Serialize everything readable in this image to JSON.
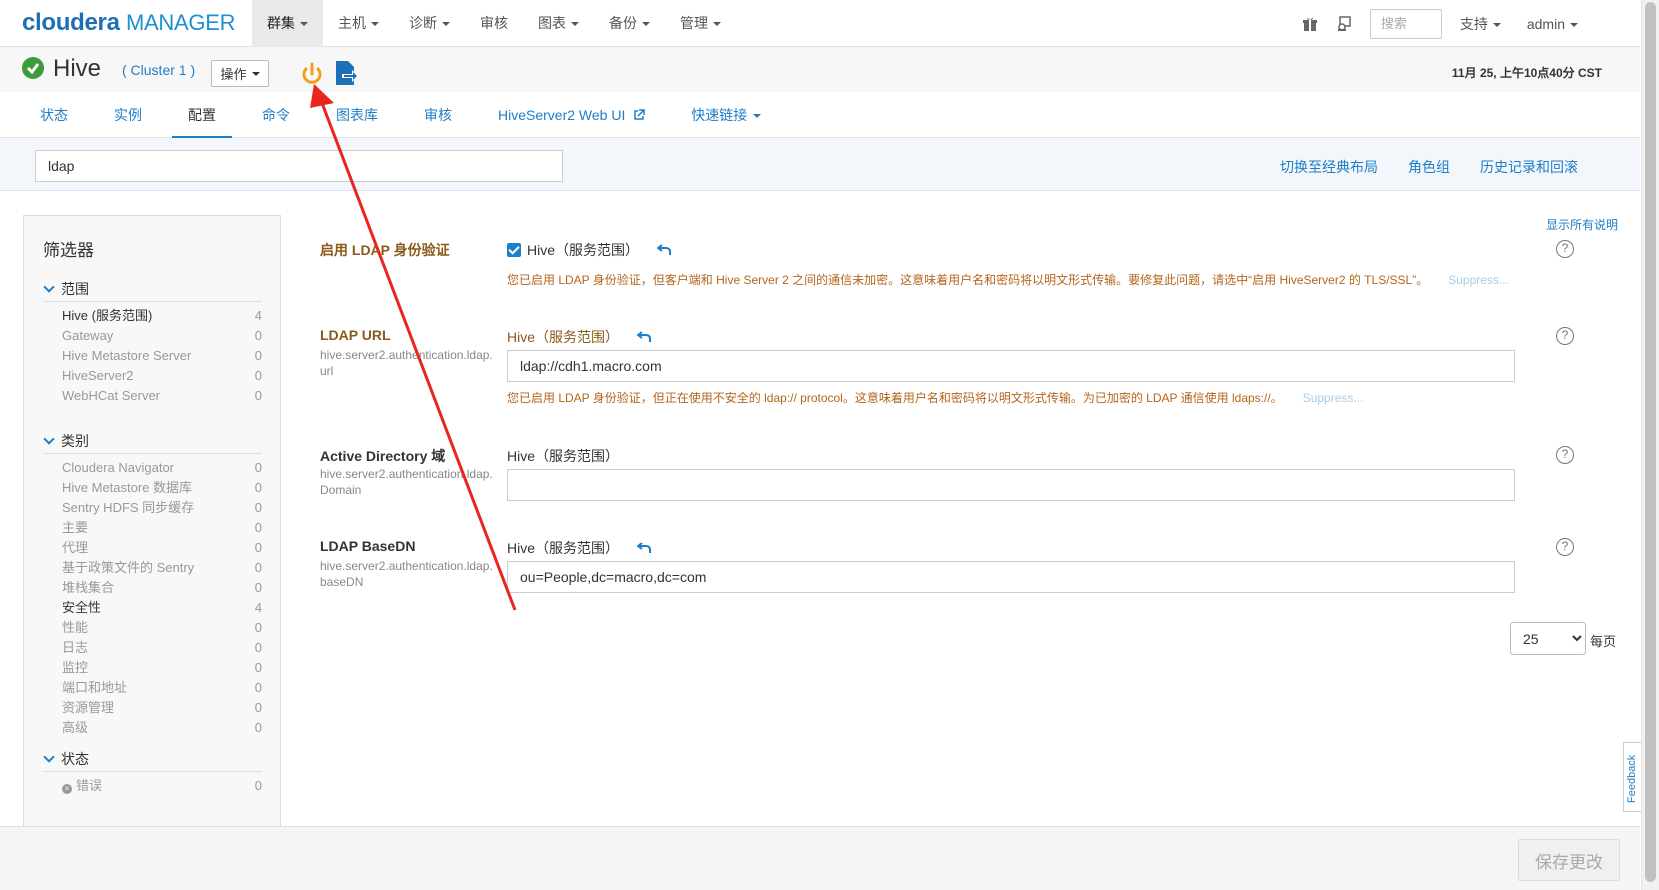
{
  "topbar": {
    "logo_brand": "cloudera",
    "logo_product": "MANAGER",
    "nav": [
      {
        "label": "群集",
        "active": true
      },
      {
        "label": "主机",
        "active": false
      },
      {
        "label": "诊断",
        "active": false
      },
      {
        "label": "审核",
        "active": false
      },
      {
        "label": "图表",
        "active": false
      },
      {
        "label": "备份",
        "active": false
      },
      {
        "label": "管理",
        "active": false
      }
    ],
    "search_placeholder": "搜索",
    "support_label": "支持",
    "user_label": "admin",
    "icons": [
      "gift-icon",
      "user-switch-icon"
    ]
  },
  "service": {
    "status_icon": "check-circle-icon",
    "name": "Hive",
    "cluster": "( Cluster 1 )",
    "actions_label": "操作",
    "timestamp": "11月 25, 上午10点40分 CST"
  },
  "tabs": [
    {
      "label": "状态"
    },
    {
      "label": "实例"
    },
    {
      "label": "配置",
      "active": true
    },
    {
      "label": "命令"
    },
    {
      "label": "图表库"
    },
    {
      "label": "审核"
    },
    {
      "label": "HiveServer2 Web UI"
    },
    {
      "label": "快速链接"
    }
  ],
  "search_band": {
    "filter_value": "ldap",
    "links": [
      "切换至经典布局",
      "角色组",
      "历史记录和回滚"
    ]
  },
  "sidebar": {
    "title": "筛选器",
    "scope": {
      "title": "范围",
      "items": [
        {
          "label": "Hive (服务范围)",
          "count": "4",
          "on": true
        },
        {
          "label": "Gateway",
          "count": "0"
        },
        {
          "label": "Hive Metastore Server",
          "count": "0"
        },
        {
          "label": "HiveServer2",
          "count": "0"
        },
        {
          "label": "WebHCat Server",
          "count": "0"
        }
      ]
    },
    "category": {
      "title": "类别",
      "items": [
        {
          "label": "Cloudera Navigator",
          "count": "0"
        },
        {
          "label": "Hive Metastore 数据库",
          "count": "0"
        },
        {
          "label": "Sentry HDFS 同步缓存",
          "count": "0"
        },
        {
          "label": "主要",
          "count": "0"
        },
        {
          "label": "代理",
          "count": "0"
        },
        {
          "label": "基于政策文件的 Sentry",
          "count": "0"
        },
        {
          "label": "堆栈集合",
          "count": "0"
        },
        {
          "label": "安全性",
          "count": "4",
          "on": true
        },
        {
          "label": "性能",
          "count": "0"
        },
        {
          "label": "日志",
          "count": "0"
        },
        {
          "label": "监控",
          "count": "0"
        },
        {
          "label": "端口和地址",
          "count": "0"
        },
        {
          "label": "资源管理",
          "count": "0"
        },
        {
          "label": "高级",
          "count": "0"
        }
      ]
    },
    "status": {
      "title": "状态",
      "items": [
        {
          "label": "错误",
          "count": "0"
        }
      ]
    }
  },
  "main": {
    "show_all": "显示所有说明",
    "props": [
      {
        "name": "启用 LDAP 身份验证",
        "key": "",
        "scope": "Hive（服务范围）",
        "checked": true,
        "warning": "您已启用 LDAP 身份验证，但客户端和 Hive Server 2 之间的通信未加密。这意味着用户名和密码将以明文形式传输。要修复此问题，请选中“启用 HiveServer2 的 TLS/SSL”。",
        "suppress": "Suppress..."
      },
      {
        "name": "LDAP URL",
        "key": "hive.server2.authentication.ldap.url",
        "scope": "Hive（服务范围）",
        "value": "ldap://cdh1.macro.com",
        "warning": "您已启用 LDAP 身份验证，但正在使用不安全的 ldap:// protocol。这意味着用户名和密码将以明文形式传输。为已加密的 LDAP 通信使用 ldaps://。",
        "suppress": "Suppress..."
      },
      {
        "name": "Active Directory 域",
        "key": "hive.server2.authentication.ldap.Domain",
        "scope": "Hive（服务范围）",
        "value": ""
      },
      {
        "name": "LDAP BaseDN",
        "key": "hive.server2.authentication.ldap.baseDN",
        "scope": "Hive（服务范围）",
        "value": "ou=People,dc=macro,dc=com"
      }
    ],
    "per_page_value": "25",
    "per_page_label": "每页"
  },
  "bottom": {
    "save_label": "保存更改"
  },
  "feedback_label": "Feedback",
  "colors": {
    "link": "#1e7ec8",
    "warning": "#b5651d",
    "annotation": "#e8251f",
    "power": "#f0a020"
  }
}
